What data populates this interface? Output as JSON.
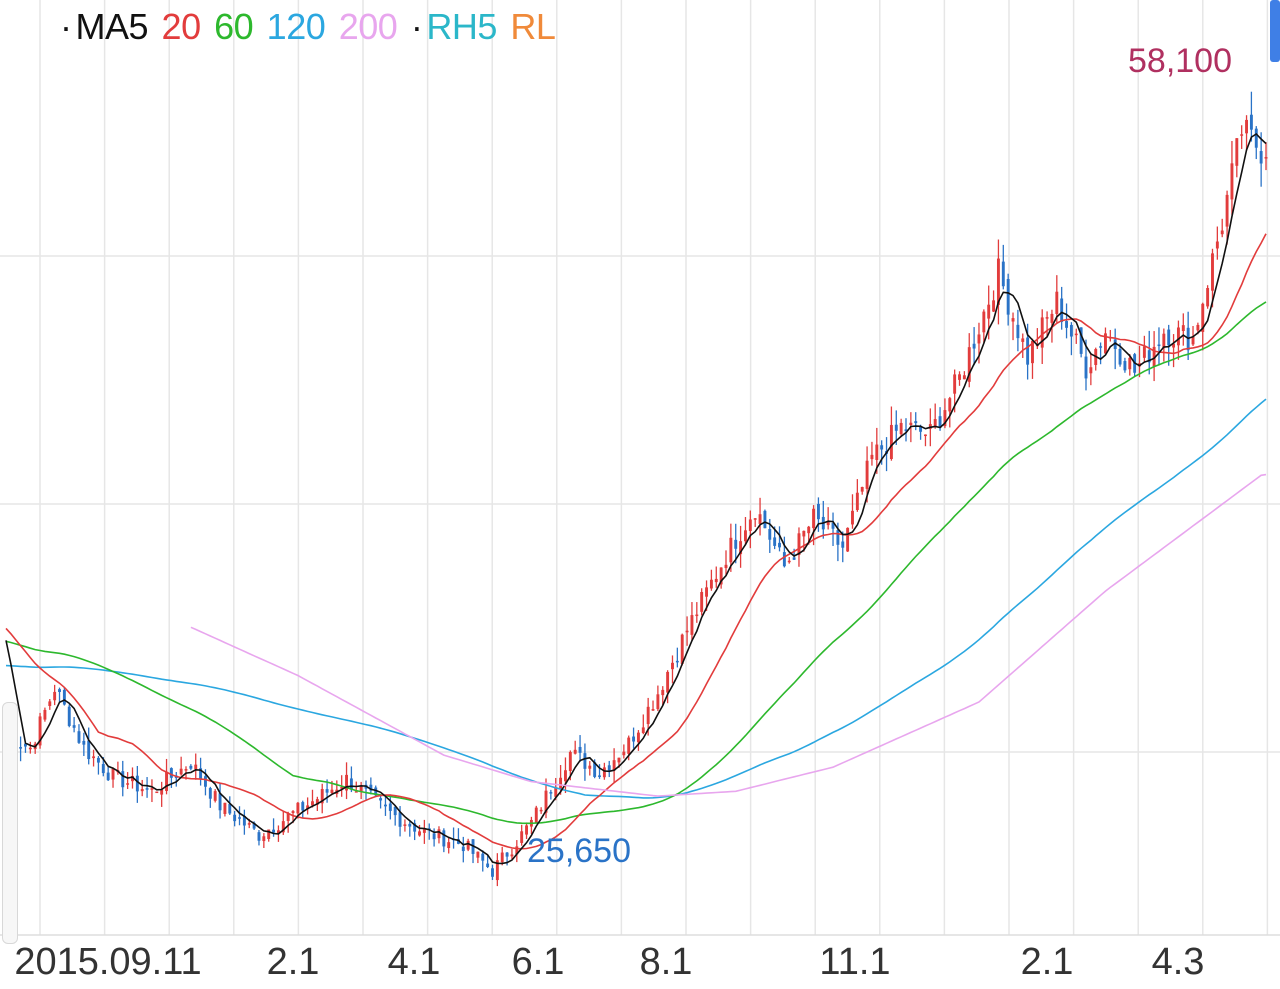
{
  "legend": {
    "bullet_ma": "·",
    "ma5": "MA5",
    "ma20": "20",
    "ma60": "60",
    "ma120": "120",
    "ma200": "200",
    "bullet_rh": "·",
    "rh5": "RH5",
    "rl": "RL"
  },
  "colors": {
    "ma5": "#111111",
    "ma20": "#e23c3c",
    "ma60": "#2db82d",
    "ma120": "#2ba7e0",
    "ma200": "#e8a6ee",
    "rh5": "#2bb7c9",
    "rl": "#f08a3a",
    "candle_up": "#e23c3c",
    "candle_down": "#2a73c7",
    "high_label": "#b03060",
    "low_label": "#2a73c7",
    "grid": "#e6e6e6"
  },
  "chart_data": {
    "type": "line",
    "subtype": "candlestick with moving averages",
    "x_labels": [
      "2015.09.11",
      "2.1",
      "4.1",
      "6.1",
      "8.1",
      "11.1",
      "2.1",
      "4.3"
    ],
    "annotations": {
      "high": "58,100",
      "low": "25,650"
    },
    "ylim": [
      22000,
      62000
    ],
    "close_anchors": [
      [
        0,
        31500
      ],
      [
        5,
        31000
      ],
      [
        10,
        33500
      ],
      [
        16,
        31000
      ],
      [
        22,
        29800
      ],
      [
        30,
        29200
      ],
      [
        38,
        30400
      ],
      [
        44,
        28600
      ],
      [
        52,
        27400
      ],
      [
        60,
        28400
      ],
      [
        70,
        29700
      ],
      [
        78,
        28400
      ],
      [
        86,
        27500
      ],
      [
        94,
        27000
      ],
      [
        100,
        25900
      ],
      [
        108,
        27900
      ],
      [
        116,
        30800
      ],
      [
        122,
        30000
      ],
      [
        128,
        31200
      ],
      [
        134,
        33300
      ],
      [
        140,
        35900
      ],
      [
        148,
        39000
      ],
      [
        154,
        41000
      ],
      [
        160,
        38500
      ],
      [
        166,
        40500
      ],
      [
        172,
        39300
      ],
      [
        178,
        43000
      ],
      [
        184,
        44300
      ],
      [
        190,
        44000
      ],
      [
        196,
        46300
      ],
      [
        204,
        50700
      ],
      [
        210,
        47200
      ],
      [
        216,
        49500
      ],
      [
        222,
        46800
      ],
      [
        226,
        48300
      ],
      [
        232,
        46600
      ],
      [
        238,
        48300
      ],
      [
        244,
        48000
      ],
      [
        250,
        52800
      ],
      [
        254,
        56600
      ],
      [
        258,
        55800
      ]
    ],
    "ma200_anchors": [
      [
        38,
        36000
      ],
      [
        60,
        34000
      ],
      [
        90,
        30700
      ],
      [
        108,
        29600
      ],
      [
        134,
        29000
      ],
      [
        150,
        29200
      ],
      [
        170,
        30200
      ],
      [
        200,
        32900
      ],
      [
        226,
        37500
      ],
      [
        258,
        42300
      ]
    ],
    "series": [
      {
        "name": "MA5"
      },
      {
        "name": "20"
      },
      {
        "name": "60"
      },
      {
        "name": "120"
      },
      {
        "name": "200"
      }
    ],
    "grid": true
  }
}
